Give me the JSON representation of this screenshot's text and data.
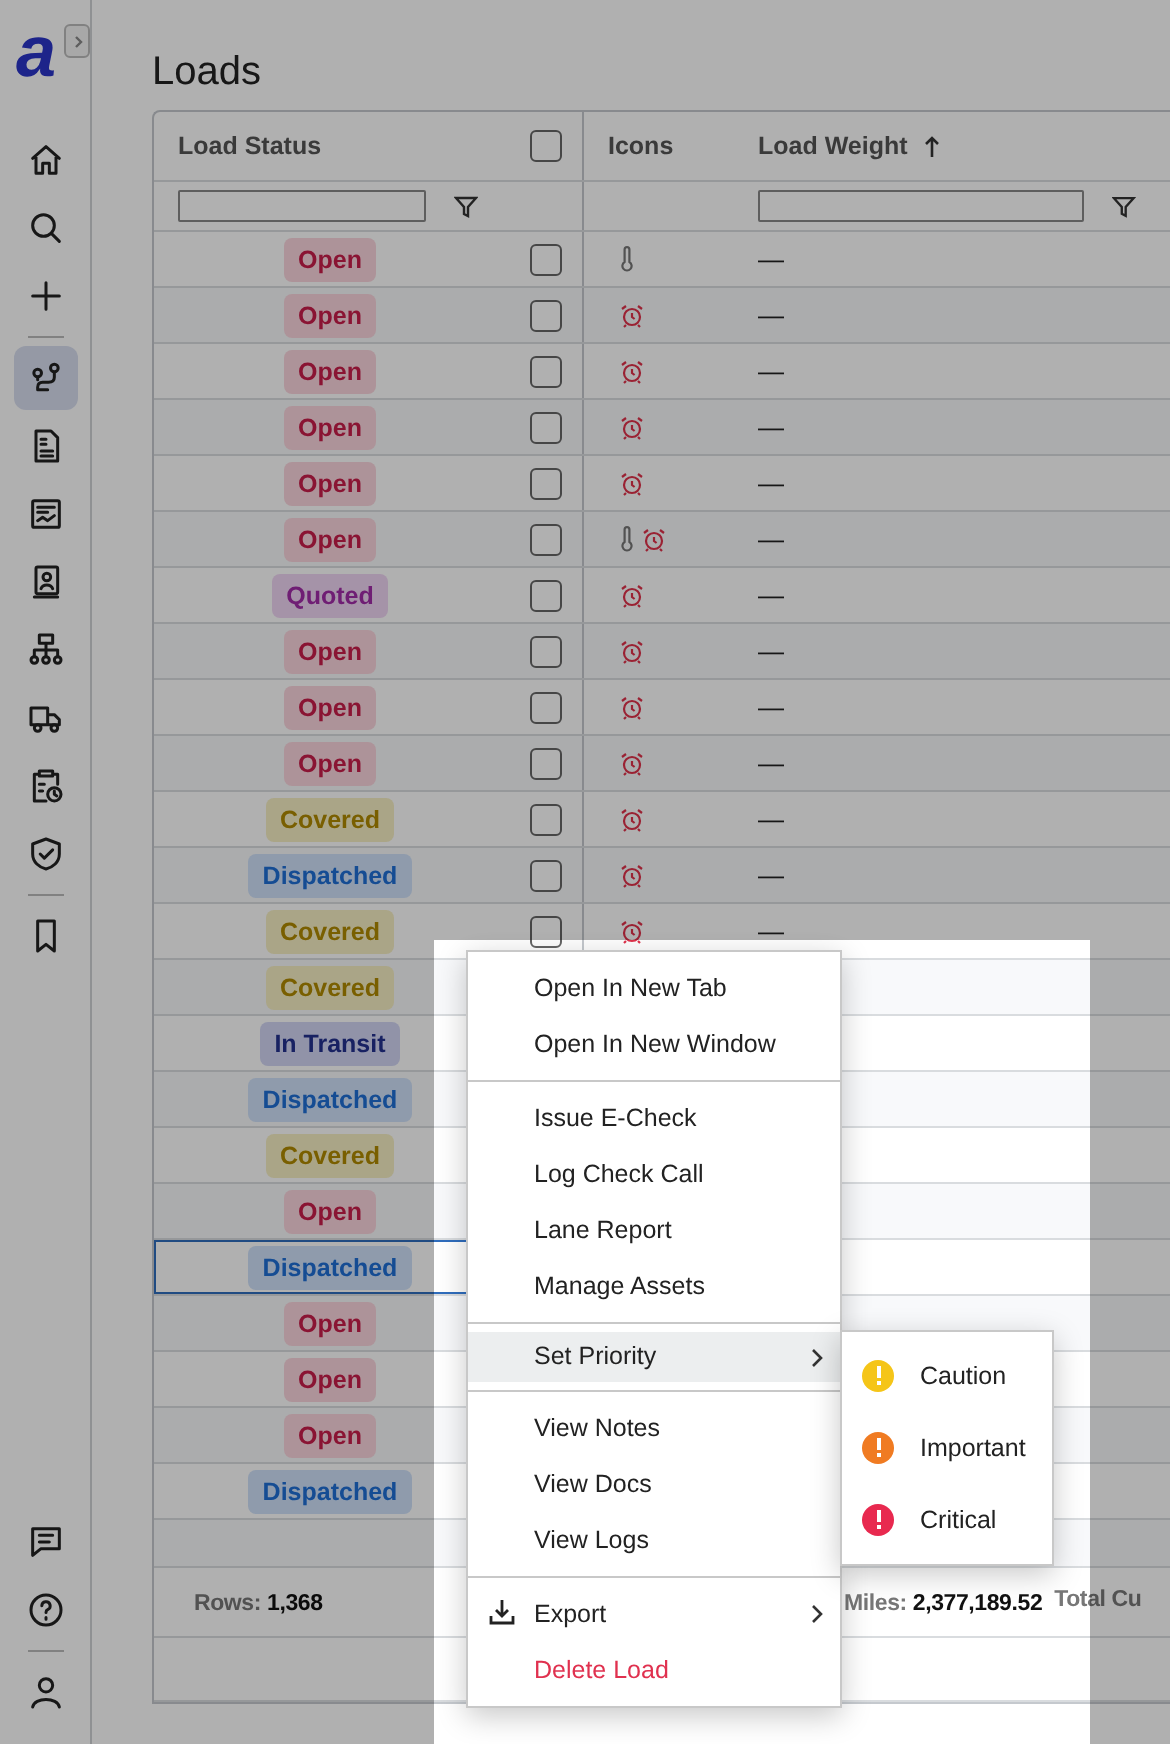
{
  "sidebar": {
    "logo": "a",
    "nav": [
      {
        "kind": "home",
        "selected": false
      },
      {
        "kind": "search",
        "selected": false
      },
      {
        "kind": "add",
        "selected": false
      },
      {
        "kind": "divider"
      },
      {
        "kind": "route",
        "selected": true
      },
      {
        "kind": "invoice",
        "selected": false
      },
      {
        "kind": "report",
        "selected": false
      },
      {
        "kind": "contact",
        "selected": false
      },
      {
        "kind": "hierarchy",
        "selected": false
      },
      {
        "kind": "truck",
        "selected": false
      },
      {
        "kind": "clipboard",
        "selected": false
      },
      {
        "kind": "shield",
        "selected": false
      },
      {
        "kind": "divider"
      },
      {
        "kind": "bookmark",
        "selected": false
      }
    ],
    "bottom": [
      {
        "kind": "chat",
        "selected": false
      },
      {
        "kind": "help",
        "selected": false
      },
      {
        "kind": "divider"
      },
      {
        "kind": "user",
        "selected": false
      }
    ]
  },
  "page": {
    "title": "Loads"
  },
  "table": {
    "columns": [
      {
        "kind": "text",
        "label": "Load Status",
        "filter": true
      },
      {
        "kind": "select_all",
        "checked": false
      },
      {
        "kind": "text",
        "label": "Icons",
        "filter": false
      },
      {
        "kind": "text",
        "label": "Load Weight",
        "sorted": true,
        "filter": true
      }
    ],
    "rows": [
      {
        "status": "Open",
        "kind": "open",
        "checked": false,
        "thermometer": true,
        "alarm": false,
        "weight": "—",
        "focused": false
      },
      {
        "status": "Open",
        "kind": "open",
        "checked": false,
        "thermometer": false,
        "alarm": true,
        "weight": "—",
        "focused": false
      },
      {
        "status": "Open",
        "kind": "open",
        "checked": false,
        "thermometer": false,
        "alarm": true,
        "weight": "—",
        "focused": false
      },
      {
        "status": "Open",
        "kind": "open",
        "checked": false,
        "thermometer": false,
        "alarm": true,
        "weight": "—",
        "focused": false
      },
      {
        "status": "Open",
        "kind": "open",
        "checked": false,
        "thermometer": false,
        "alarm": true,
        "weight": "—",
        "focused": false
      },
      {
        "status": "Open",
        "kind": "open",
        "checked": false,
        "thermometer": true,
        "alarm": true,
        "weight": "—",
        "focused": false
      },
      {
        "status": "Quoted",
        "kind": "quoted",
        "checked": false,
        "thermometer": false,
        "alarm": true,
        "weight": "—",
        "focused": false
      },
      {
        "status": "Open",
        "kind": "open",
        "checked": false,
        "thermometer": false,
        "alarm": true,
        "weight": "—",
        "focused": false
      },
      {
        "status": "Open",
        "kind": "open",
        "checked": false,
        "thermometer": false,
        "alarm": true,
        "weight": "—",
        "focused": false
      },
      {
        "status": "Open",
        "kind": "open",
        "checked": false,
        "thermometer": false,
        "alarm": true,
        "weight": "—",
        "focused": false
      },
      {
        "status": "Covered",
        "kind": "covered",
        "checked": false,
        "thermometer": false,
        "alarm": true,
        "weight": "—",
        "focused": false
      },
      {
        "status": "Dispatched",
        "kind": "dispatched",
        "checked": false,
        "thermometer": false,
        "alarm": true,
        "weight": "—",
        "focused": false
      },
      {
        "status": "Covered",
        "kind": "covered",
        "checked": false,
        "thermometer": false,
        "alarm": true,
        "weight": "—",
        "focused": false
      },
      {
        "status": "Covered",
        "kind": "covered",
        "focused": false
      },
      {
        "status": "In Transit",
        "kind": "in_transit",
        "focused": false
      },
      {
        "status": "Dispatched",
        "kind": "dispatched",
        "focused": false
      },
      {
        "status": "Covered",
        "kind": "covered",
        "focused": false
      },
      {
        "status": "Open",
        "kind": "open",
        "focused": false
      },
      {
        "status": "Dispatched",
        "kind": "dispatched",
        "focused": true
      },
      {
        "status": "Open",
        "kind": "open",
        "focused": false
      },
      {
        "status": "Open",
        "kind": "open",
        "focused": false
      },
      {
        "status": "Open",
        "kind": "open",
        "focused": false
      },
      {
        "status": "Dispatched",
        "kind": "dispatched",
        "focused": false
      }
    ],
    "footer": [
      {
        "label": "Rows:",
        "value": "1,368"
      },
      {
        "label": "Miles:",
        "value": "2,377,189.52"
      },
      {
        "label": "Total Cu"
      }
    ]
  },
  "context_menu": {
    "groups": [
      [
        {
          "label": "Open In New Tab",
          "kind": "plain",
          "highlighted": false,
          "has_submenu": false
        },
        {
          "label": "Open In New Window",
          "kind": "plain",
          "highlighted": false,
          "has_submenu": false
        }
      ],
      [
        {
          "label": "Issue E-Check",
          "kind": "plain",
          "highlighted": false,
          "has_submenu": false
        },
        {
          "label": "Log Check Call",
          "kind": "plain",
          "highlighted": false,
          "has_submenu": false
        },
        {
          "label": "Lane Report",
          "kind": "plain",
          "highlighted": false,
          "has_submenu": false
        },
        {
          "label": "Manage Assets",
          "kind": "plain",
          "highlighted": false,
          "has_submenu": false
        }
      ],
      [
        {
          "label": "Set Priority",
          "kind": "plain",
          "highlighted": true,
          "has_submenu": true
        }
      ],
      [
        {
          "label": "View Notes",
          "kind": "plain",
          "highlighted": false,
          "has_submenu": false
        },
        {
          "label": "View Docs",
          "kind": "plain",
          "highlighted": false,
          "has_submenu": false
        },
        {
          "label": "View Logs",
          "kind": "plain",
          "highlighted": false,
          "has_submenu": false
        }
      ],
      [
        {
          "label": "Export",
          "kind": "export",
          "highlighted": false,
          "has_submenu": true
        },
        {
          "label": "Delete Load",
          "kind": "danger",
          "highlighted": false,
          "has_submenu": false
        }
      ]
    ],
    "submenu": {
      "items": [
        {
          "label": "Caution",
          "color": "#f5c518"
        },
        {
          "label": "Important",
          "color": "#f07b22"
        },
        {
          "label": "Critical",
          "color": "#e8294f"
        }
      ]
    }
  }
}
